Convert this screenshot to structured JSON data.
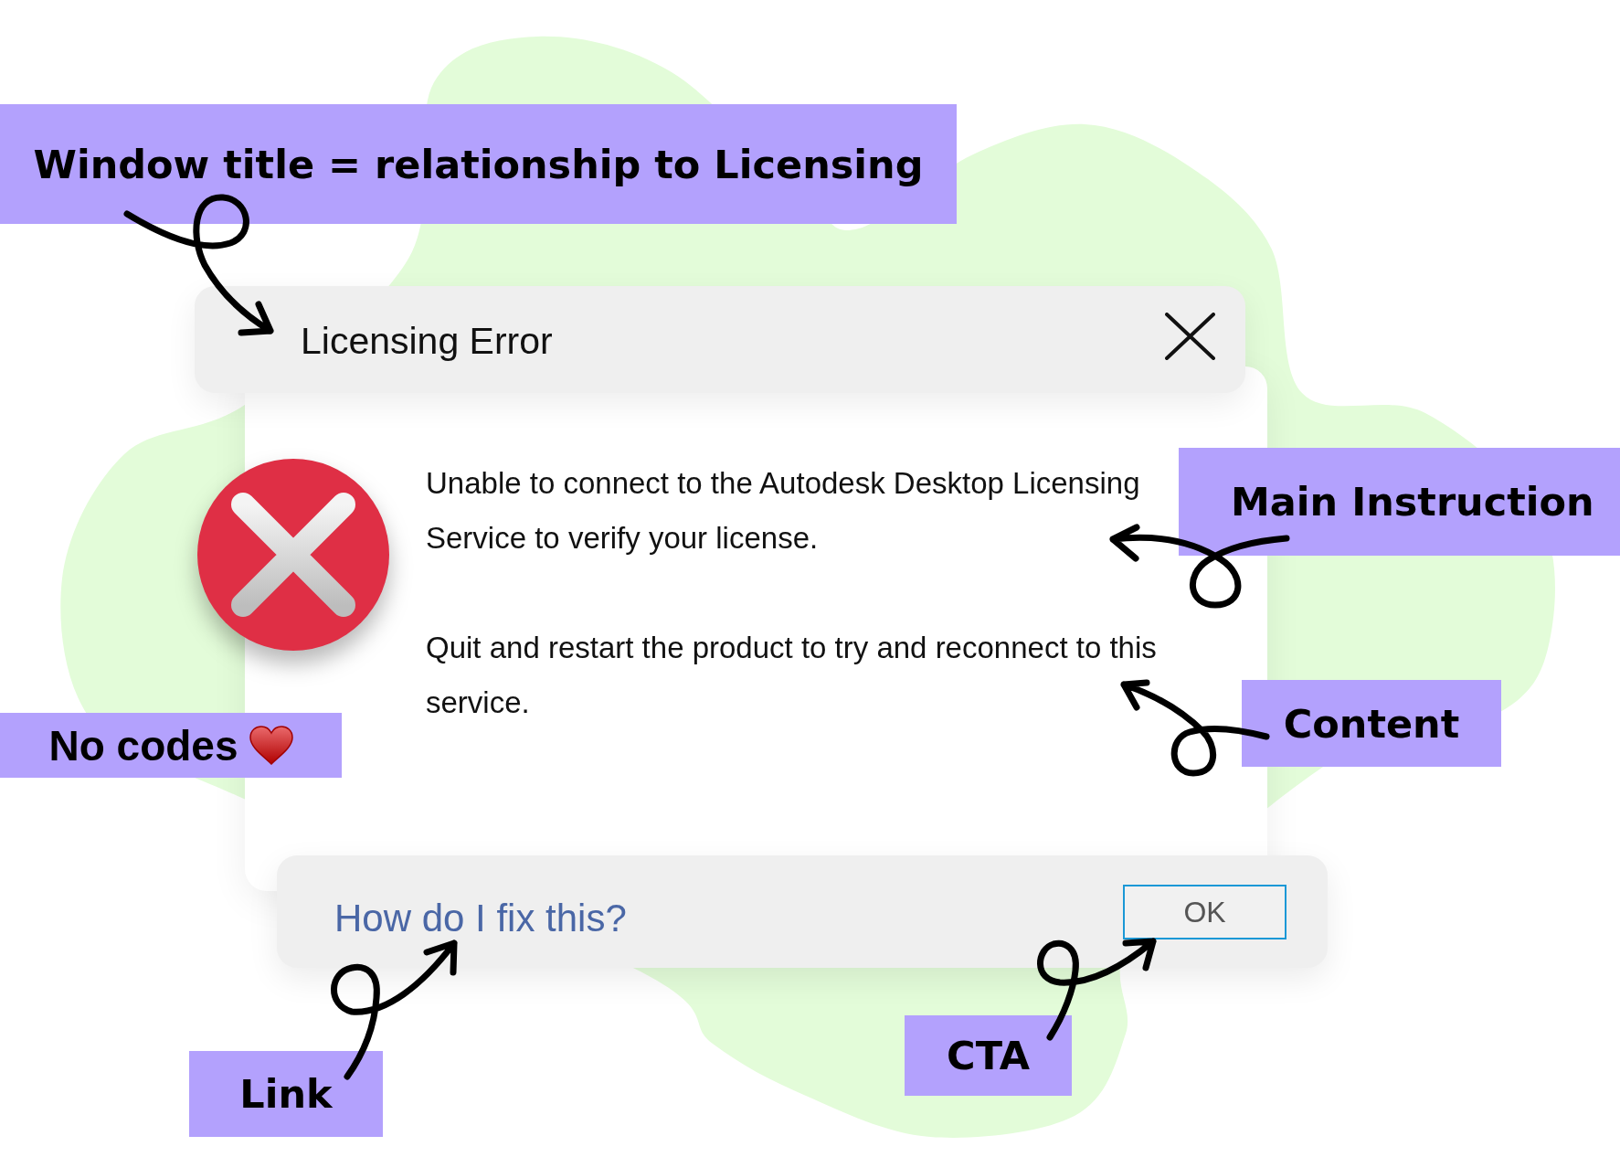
{
  "annotations": [
    {
      "text": "Window title = relationship to Licensing"
    },
    {
      "text": "Main Instruction"
    },
    {
      "text": "Content"
    },
    {
      "text": "No codes"
    },
    {
      "text": "CTA"
    },
    {
      "text": "Link"
    }
  ],
  "dialog": {
    "title": "Licensing Error",
    "main_instruction": "Unable to connect to the Autodesk Desktop Licensing Service to verify your license.",
    "content": "Quit and restart the product to try and reconnect to this service.",
    "link": "How do I fix this?",
    "buttons": [
      {
        "label": "OK",
        "focused": true
      }
    ]
  }
}
